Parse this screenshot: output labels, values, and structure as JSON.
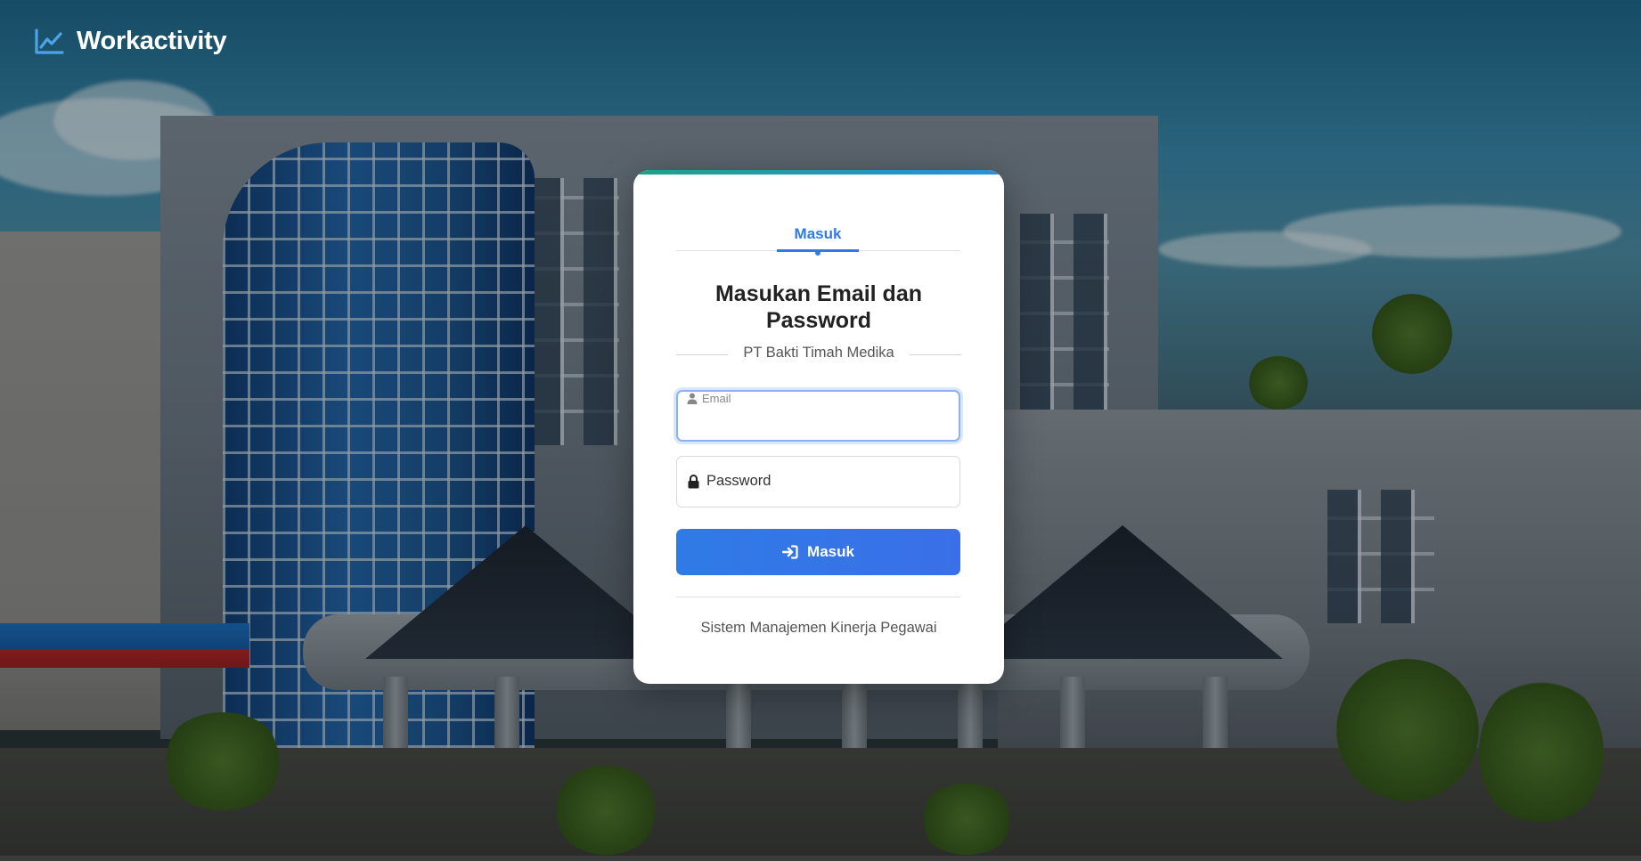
{
  "brand": {
    "name": "Workactivity",
    "icon": "line-chart-icon",
    "icon_color": "#4da3e8"
  },
  "tabs": [
    {
      "label": "Masuk",
      "active": true
    }
  ],
  "heading": "Masukan Email dan Password",
  "company": "PT Bakti Timah Medika",
  "email": {
    "label": "Email",
    "value": "",
    "icon": "user-icon"
  },
  "password": {
    "placeholder": "Password",
    "icon": "lock-icon"
  },
  "submit": {
    "label": "Masuk",
    "icon": "sign-in-icon",
    "color": "#2f7be6"
  },
  "footer": "Sistem Manajemen Kinerja Pegawai"
}
